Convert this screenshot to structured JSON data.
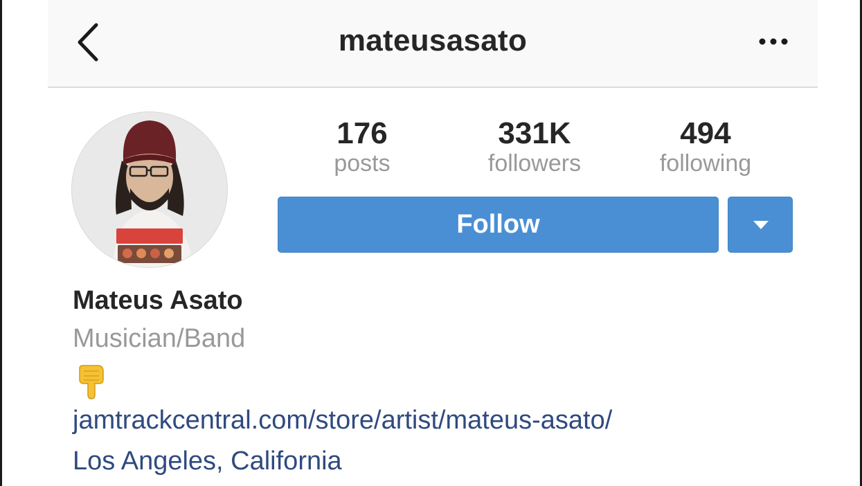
{
  "header": {
    "username": "mateusasato",
    "back_icon": "chevron-left-icon",
    "more_icon": "more-horizontal-icon"
  },
  "profile": {
    "avatar_description": "profile-photo",
    "stats": [
      {
        "count": "176",
        "label": "posts"
      },
      {
        "count": "331K",
        "label": "followers"
      },
      {
        "count": "494",
        "label": "following"
      }
    ],
    "follow_label": "Follow",
    "dropdown_icon": "caret-down-icon"
  },
  "bio": {
    "name": "Mateus Asato",
    "category": "Musician/Band",
    "emoji_icon": "pointing-down-hand-icon",
    "link": "jamtrackcentral.com/store/artist/mateus-asato/",
    "location": "Los Angeles, California"
  },
  "colors": {
    "accent": "#4a8fd3",
    "link": "#2f4a7f",
    "muted": "#999999",
    "text": "#262626"
  }
}
